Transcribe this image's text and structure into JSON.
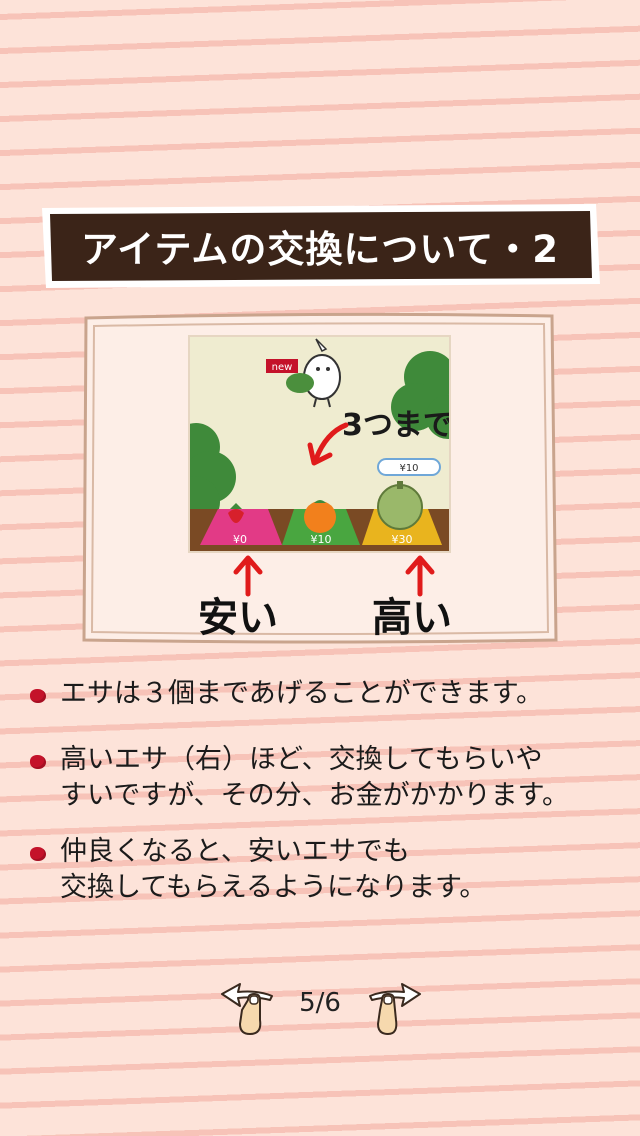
{
  "title": "アイテムの交換について・2",
  "illustration": {
    "new_badge": "new",
    "annotation_top": "3つまで",
    "price_bubble": "¥10",
    "prices": [
      "¥0",
      "¥10",
      "¥30"
    ],
    "label_cheap": "安い",
    "label_expensive": "高い"
  },
  "bullets": [
    "エサは３個まであげることができます。",
    "高いエサ（右）ほど、交換してもらいや\nすいですが、その分、お金がかかります。",
    "仲良くなると、安いエサでも\n交換してもらえるようになります。"
  ],
  "pager": {
    "label": "5/6",
    "prev_icon": "swipe-left-hand-icon",
    "next_icon": "swipe-right-hand-icon"
  },
  "colors": {
    "banner": "#3b2418",
    "bullet": "#c4122a",
    "arrow": "#e01b1b"
  }
}
